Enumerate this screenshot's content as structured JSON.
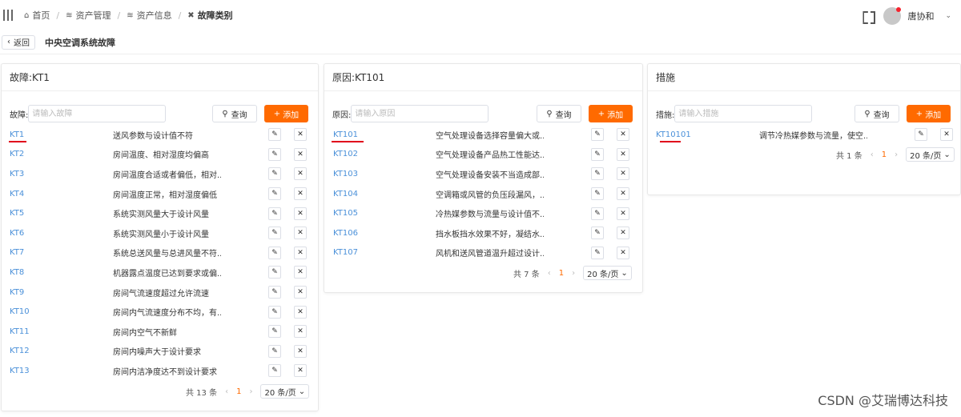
{
  "breadcrumb": [
    {
      "label": "首页",
      "icon": "home-icon",
      "glyph": "🏠"
    },
    {
      "label": "资产管理",
      "icon": "layers-icon",
      "glyph": "≋"
    },
    {
      "label": "资产信息",
      "icon": "layers-icon",
      "glyph": "≋"
    },
    {
      "label": "故障类别",
      "icon": "tools-icon",
      "glyph": "✖"
    }
  ],
  "user": {
    "name": "唐协和"
  },
  "subheader": {
    "back_label": "返回",
    "title": "中央空调系统故障"
  },
  "panels": [
    {
      "title": "故障:KT1",
      "search_label": "故障:",
      "placeholder": "请输入故障",
      "query_label": "查询",
      "add_label": "添加",
      "rows": [
        {
          "code": "KT1",
          "desc": "送风参数与设计值不符"
        },
        {
          "code": "KT2",
          "desc": "房间温度、相对湿度均偏高"
        },
        {
          "code": "KT3",
          "desc": "房间温度合适或者偏低，相对..."
        },
        {
          "code": "KT4",
          "desc": "房间温度正常，相对湿度偏低"
        },
        {
          "code": "KT5",
          "desc": "系统实测风量大于设计风量"
        },
        {
          "code": "KT6",
          "desc": "系统实测风量小于设计风量"
        },
        {
          "code": "KT7",
          "desc": "系统总送风量与总进风量不符..."
        },
        {
          "code": "KT8",
          "desc": "机器露点温度已达到要求或偏..."
        },
        {
          "code": "KT9",
          "desc": "房间气流速度超过允许流速"
        },
        {
          "code": "KT10",
          "desc": "房间内气流速度分布不均，有..."
        },
        {
          "code": "KT11",
          "desc": "房间内空气不新鲜"
        },
        {
          "code": "KT12",
          "desc": "房间内噪声大于设计要求"
        },
        {
          "code": "KT13",
          "desc": "房间内洁净度达不到设计要求"
        }
      ],
      "total": "共 13 条",
      "page": "1",
      "page_size": "20 条/页"
    },
    {
      "title": "原因:KT101",
      "search_label": "原因:",
      "placeholder": "请输入原因",
      "query_label": "查询",
      "add_label": "添加",
      "rows": [
        {
          "code": "KT101",
          "desc": "空气处理设备选择容量偏大或..."
        },
        {
          "code": "KT102",
          "desc": "空气处理设备产品热工性能达..."
        },
        {
          "code": "KT103",
          "desc": "空气处理设备安装不当造成部..."
        },
        {
          "code": "KT104",
          "desc": "空调箱或风管的负压段漏风，..."
        },
        {
          "code": "KT105",
          "desc": "冷热媒参数与流量与设计值不..."
        },
        {
          "code": "KT106",
          "desc": "挡水板挡水效果不好，凝结水..."
        },
        {
          "code": "KT107",
          "desc": "风机和送风管道温升超过设计..."
        }
      ],
      "total": "共 7 条",
      "page": "1",
      "page_size": "20 条/页"
    },
    {
      "title": "措施",
      "search_label": "措施:",
      "placeholder": "请输入措施",
      "query_label": "查询",
      "add_label": "添加",
      "rows": [
        {
          "code": "KT10101",
          "desc": "调节冷热媒参数与流量，使空..."
        }
      ],
      "total": "共 1 条",
      "page": "1",
      "page_size": "20 条/页"
    }
  ],
  "watermark": "CSDN @艾瑞博达科技",
  "colors": {
    "accent": "#ff6a00",
    "link": "#4a90d9",
    "highlight": "#e0001b"
  }
}
